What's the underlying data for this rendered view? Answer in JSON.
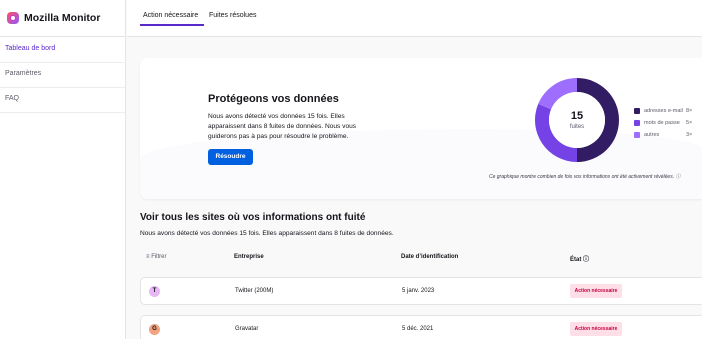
{
  "app": {
    "title": "Mozilla Monitor"
  },
  "sidebar": {
    "items": [
      {
        "label": "Tableau de bord",
        "active": true
      },
      {
        "label": "Paramètres",
        "active": false
      },
      {
        "label": "FAQ",
        "active": false
      }
    ]
  },
  "tabs": [
    {
      "label": "Action nécessaire",
      "active": true
    },
    {
      "label": "Fuites résolues",
      "active": false
    }
  ],
  "hero": {
    "title": "Protégeons vos données",
    "text": "Nous avons détecté vos données 15 fois. Elles apparaissent dans 8 fuites de données. Nous vous guiderons pas à pas pour résoudre le problème.",
    "button": "Résoudre",
    "chart_caption": "Ce graphique montre combien de fois vos informations ont été activement révélées."
  },
  "chart_data": {
    "type": "pie",
    "total": "15",
    "total_label": "fuites",
    "categories": [
      "adresses e-mail",
      "mots de passe",
      "autres"
    ],
    "values": [
      8,
      5,
      3
    ],
    "colors": [
      "#321c64",
      "#7542e5",
      "#9e6eff"
    ],
    "value_labels": [
      "8×",
      "5×",
      "3×"
    ]
  },
  "section": {
    "title": "Voir tous les sites où vos informations ont fuité",
    "subtitle": "Nous avons détecté vos données 15 fois. Elles apparaissent dans 8 fuites de données."
  },
  "table": {
    "filter_label": "Filtrer",
    "columns": [
      "Entreprise",
      "Date d’identification",
      "État"
    ],
    "rows": [
      {
        "initial": "T",
        "avatar_color": "#e7b6f4",
        "company": "Twitter (200M)",
        "date": "5 janv. 2023",
        "state": "Action nécessaire"
      },
      {
        "initial": "G",
        "avatar_color": "#f1a27e",
        "company": "Gravatar",
        "date": "5 déc. 2021",
        "state": "Action nécessaire"
      }
    ]
  },
  "colors": {
    "accent": "#592acb",
    "button": "#0060df",
    "badge_bg": "#ffdfe7",
    "badge_text": "#c50042"
  }
}
